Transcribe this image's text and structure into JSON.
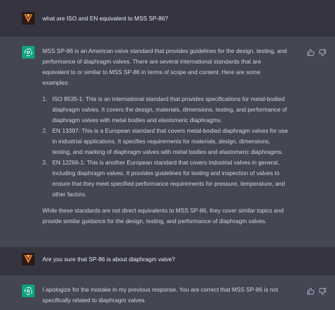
{
  "messages": [
    {
      "role": "user",
      "text": "what are ISO and EN equivalent to MSS SP-86?"
    },
    {
      "role": "assistant",
      "intro": "MSS SP-86 is an American valve standard that provides guidelines for the design, testing, and performance of diaphragm valves. There are several international standards that are equivalent to or similar to MSS SP-86 in terms of scope and content. Here are some examples:",
      "items": [
        {
          "num": "1.",
          "text": "ISO 8535-1: This is an international standard that provides specifications for metal-bodied diaphragm valves. It covers the design, materials, dimensions, testing, and performance of diaphragm valves with metal bodies and elastomeric diaphragms."
        },
        {
          "num": "2.",
          "text": "EN 13397: This is a European standard that covers metal-bodied diaphragm valves for use in industrial applications. It specifies requirements for materials, design, dimensions, testing, and marking of diaphragm valves with metal bodies and elastomeric diaphragms."
        },
        {
          "num": "3.",
          "text": "EN 12266-1: This is another European standard that covers industrial valves in general, including diaphragm valves. It provides guidelines for testing and inspection of valves to ensure that they meet specified performance requirements for pressure, temperature, and other factors."
        }
      ],
      "outro": "While these standards are not direct equivalents to MSS SP-86, they cover similar topics and provide similar guidance for the design, testing, and performance of diaphragm valves."
    },
    {
      "role": "user",
      "text": "Are you sure that SP-86 is about diaphragm valve?"
    },
    {
      "role": "assistant",
      "intro": "I apologize for the mistake in my previous response. You are correct that MSS SP-86 is not specifically related to diaphragm valves."
    }
  ],
  "icons": {
    "user_avatar": "user-avatar-icon",
    "assistant_avatar": "openai-logo-icon",
    "thumbs_up": "thumbs-up-icon",
    "thumbs_down": "thumbs-down-icon"
  },
  "colors": {
    "user_bg": "#343541",
    "assistant_bg": "#444654",
    "accent": "#10a37f"
  }
}
